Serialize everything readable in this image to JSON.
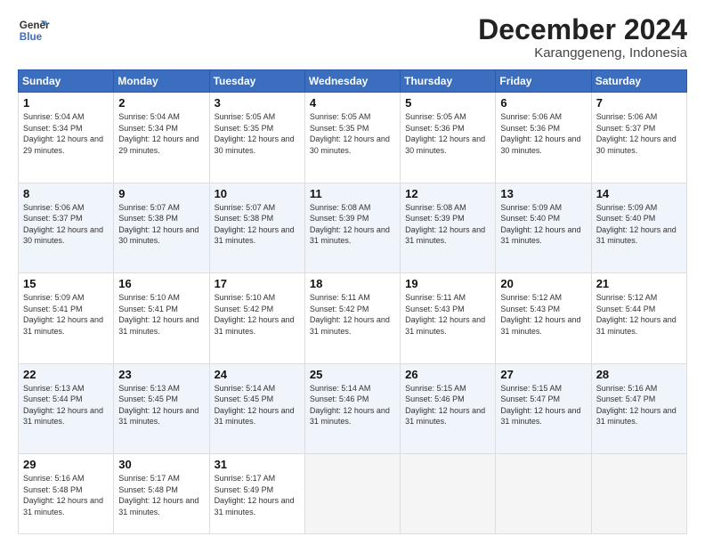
{
  "logo": {
    "line1": "General",
    "line2": "Blue"
  },
  "calendar": {
    "title": "December 2024",
    "subtitle": "Karanggeneng, Indonesia",
    "days_of_week": [
      "Sunday",
      "Monday",
      "Tuesday",
      "Wednesday",
      "Thursday",
      "Friday",
      "Saturday"
    ],
    "weeks": [
      [
        null,
        null,
        {
          "day": 1,
          "sunrise": "5:04 AM",
          "sunset": "5:34 PM",
          "daylight": "12 hours and 29 minutes."
        },
        {
          "day": 2,
          "sunrise": "5:04 AM",
          "sunset": "5:34 PM",
          "daylight": "12 hours and 29 minutes."
        },
        {
          "day": 3,
          "sunrise": "5:05 AM",
          "sunset": "5:35 PM",
          "daylight": "12 hours and 30 minutes."
        },
        {
          "day": 4,
          "sunrise": "5:05 AM",
          "sunset": "5:35 PM",
          "daylight": "12 hours and 30 minutes."
        },
        {
          "day": 5,
          "sunrise": "5:05 AM",
          "sunset": "5:36 PM",
          "daylight": "12 hours and 30 minutes."
        },
        {
          "day": 6,
          "sunrise": "5:06 AM",
          "sunset": "5:36 PM",
          "daylight": "12 hours and 30 minutes."
        },
        {
          "day": 7,
          "sunrise": "5:06 AM",
          "sunset": "5:37 PM",
          "daylight": "12 hours and 30 minutes."
        }
      ],
      [
        {
          "day": 8,
          "sunrise": "5:06 AM",
          "sunset": "5:37 PM",
          "daylight": "12 hours and 30 minutes."
        },
        {
          "day": 9,
          "sunrise": "5:07 AM",
          "sunset": "5:38 PM",
          "daylight": "12 hours and 30 minutes."
        },
        {
          "day": 10,
          "sunrise": "5:07 AM",
          "sunset": "5:38 PM",
          "daylight": "12 hours and 31 minutes."
        },
        {
          "day": 11,
          "sunrise": "5:08 AM",
          "sunset": "5:39 PM",
          "daylight": "12 hours and 31 minutes."
        },
        {
          "day": 12,
          "sunrise": "5:08 AM",
          "sunset": "5:39 PM",
          "daylight": "12 hours and 31 minutes."
        },
        {
          "day": 13,
          "sunrise": "5:09 AM",
          "sunset": "5:40 PM",
          "daylight": "12 hours and 31 minutes."
        },
        {
          "day": 14,
          "sunrise": "5:09 AM",
          "sunset": "5:40 PM",
          "daylight": "12 hours and 31 minutes."
        }
      ],
      [
        {
          "day": 15,
          "sunrise": "5:09 AM",
          "sunset": "5:41 PM",
          "daylight": "12 hours and 31 minutes."
        },
        {
          "day": 16,
          "sunrise": "5:10 AM",
          "sunset": "5:41 PM",
          "daylight": "12 hours and 31 minutes."
        },
        {
          "day": 17,
          "sunrise": "5:10 AM",
          "sunset": "5:42 PM",
          "daylight": "12 hours and 31 minutes."
        },
        {
          "day": 18,
          "sunrise": "5:11 AM",
          "sunset": "5:42 PM",
          "daylight": "12 hours and 31 minutes."
        },
        {
          "day": 19,
          "sunrise": "5:11 AM",
          "sunset": "5:43 PM",
          "daylight": "12 hours and 31 minutes."
        },
        {
          "day": 20,
          "sunrise": "5:12 AM",
          "sunset": "5:43 PM",
          "daylight": "12 hours and 31 minutes."
        },
        {
          "day": 21,
          "sunrise": "5:12 AM",
          "sunset": "5:44 PM",
          "daylight": "12 hours and 31 minutes."
        }
      ],
      [
        {
          "day": 22,
          "sunrise": "5:13 AM",
          "sunset": "5:44 PM",
          "daylight": "12 hours and 31 minutes."
        },
        {
          "day": 23,
          "sunrise": "5:13 AM",
          "sunset": "5:45 PM",
          "daylight": "12 hours and 31 minutes."
        },
        {
          "day": 24,
          "sunrise": "5:14 AM",
          "sunset": "5:45 PM",
          "daylight": "12 hours and 31 minutes."
        },
        {
          "day": 25,
          "sunrise": "5:14 AM",
          "sunset": "5:46 PM",
          "daylight": "12 hours and 31 minutes."
        },
        {
          "day": 26,
          "sunrise": "5:15 AM",
          "sunset": "5:46 PM",
          "daylight": "12 hours and 31 minutes."
        },
        {
          "day": 27,
          "sunrise": "5:15 AM",
          "sunset": "5:47 PM",
          "daylight": "12 hours and 31 minutes."
        },
        {
          "day": 28,
          "sunrise": "5:16 AM",
          "sunset": "5:47 PM",
          "daylight": "12 hours and 31 minutes."
        }
      ],
      [
        {
          "day": 29,
          "sunrise": "5:16 AM",
          "sunset": "5:48 PM",
          "daylight": "12 hours and 31 minutes."
        },
        {
          "day": 30,
          "sunrise": "5:17 AM",
          "sunset": "5:48 PM",
          "daylight": "12 hours and 31 minutes."
        },
        {
          "day": 31,
          "sunrise": "5:17 AM",
          "sunset": "5:49 PM",
          "daylight": "12 hours and 31 minutes."
        },
        null,
        null,
        null,
        null
      ]
    ]
  }
}
